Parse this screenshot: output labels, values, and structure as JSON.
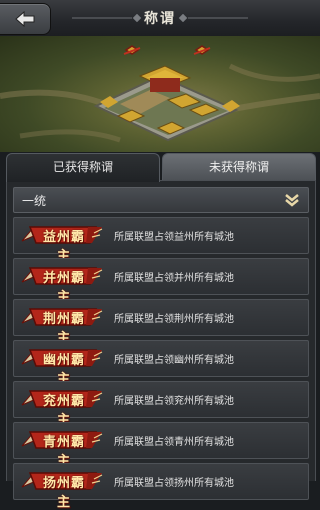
{
  "header": {
    "title": "称谓"
  },
  "tabs": [
    {
      "label": "已获得称谓",
      "active": true
    },
    {
      "label": "未获得称谓",
      "active": false
    }
  ],
  "group": {
    "label": "一统"
  },
  "titles": [
    {
      "name": "益州霸主",
      "desc": "所属联盟占领益州所有城池"
    },
    {
      "name": "并州霸主",
      "desc": "所属联盟占领并州所有城池"
    },
    {
      "name": "荆州霸主",
      "desc": "所属联盟占领荆州所有城池"
    },
    {
      "name": "幽州霸主",
      "desc": "所属联盟占领幽州所有城池"
    },
    {
      "name": "兖州霸主",
      "desc": "所属联盟占领兖州所有城池"
    },
    {
      "name": "青州霸主",
      "desc": "所属联盟占领青州所有城池"
    },
    {
      "name": "扬州霸主",
      "desc": "所属联盟占领扬州所有城池"
    }
  ],
  "icons": {
    "back": "back-arrow-icon",
    "expand": "chevron-down-icon",
    "badge": "ribbon-badge-icon"
  },
  "colors": {
    "badge_red": "#b3261a",
    "badge_text": "#ffe7a8",
    "panel": "#26292c"
  }
}
